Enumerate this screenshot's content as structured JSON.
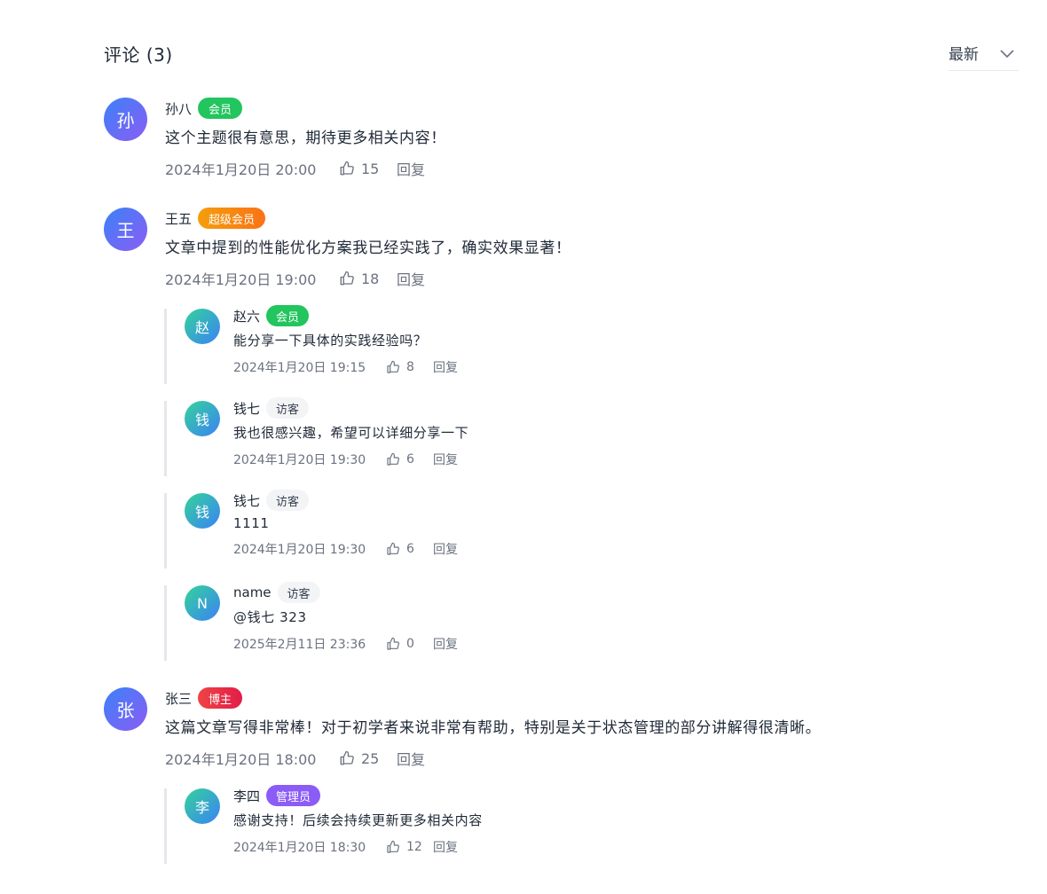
{
  "header": {
    "title": "评论 (3)",
    "sort_label": "最新"
  },
  "colors": {
    "avatar_gradient": [
      "#3b82f6",
      "#8b5cf6"
    ],
    "reply_avatar_gradient": [
      "#34d399",
      "#3b82f6"
    ]
  },
  "comments": [
    {
      "initial": "孙",
      "name": "孙八",
      "badge": "会员",
      "text": "这个主题很有意思，期待更多相关内容！",
      "time": "2024年1月20日 20:00",
      "likes": "15",
      "reply_label": "回复",
      "replies": []
    },
    {
      "initial": "王",
      "name": "王五",
      "badge": "超级会员",
      "text": "文章中提到的性能优化方案我已经实践了，确实效果显著！",
      "time": "2024年1月20日 19:00",
      "likes": "18",
      "reply_label": "回复",
      "replies": [
        {
          "initial": "赵",
          "name": "赵六",
          "badge": "会员",
          "text": "能分享一下具体的实践经验吗？",
          "time": "2024年1月20日 19:15",
          "likes": "8",
          "reply_label": "回复"
        },
        {
          "initial": "钱",
          "name": "钱七",
          "badge": "访客",
          "text": "我也很感兴趣，希望可以详细分享一下",
          "time": "2024年1月20日 19:30",
          "likes": "6",
          "reply_label": "回复"
        },
        {
          "initial": "钱",
          "name": "钱七",
          "badge": "访客",
          "text": "1111",
          "time": "2024年1月20日 19:30",
          "likes": "6",
          "reply_label": "回复"
        },
        {
          "initial": "N",
          "name": "name",
          "badge": "访客",
          "text": "@钱七 323",
          "time": "2025年2月11日 23:36",
          "likes": "0",
          "reply_label": "回复"
        }
      ]
    },
    {
      "initial": "张",
      "name": "张三",
      "badge": "博主",
      "text": "这篇文章写得非常棒！对于初学者来说非常有帮助，特别是关于状态管理的部分讲解得很清晰。",
      "time": "2024年1月20日 18:00",
      "likes": "25",
      "reply_label": "回复",
      "replies": [
        {
          "initial": "李",
          "name": "李四",
          "badge": "管理员",
          "text": "感谢支持！后续会持续更新更多相关内容",
          "time": "2024年1月20日 18:30",
          "likes": "12",
          "reply_label": "回复"
        }
      ]
    }
  ]
}
